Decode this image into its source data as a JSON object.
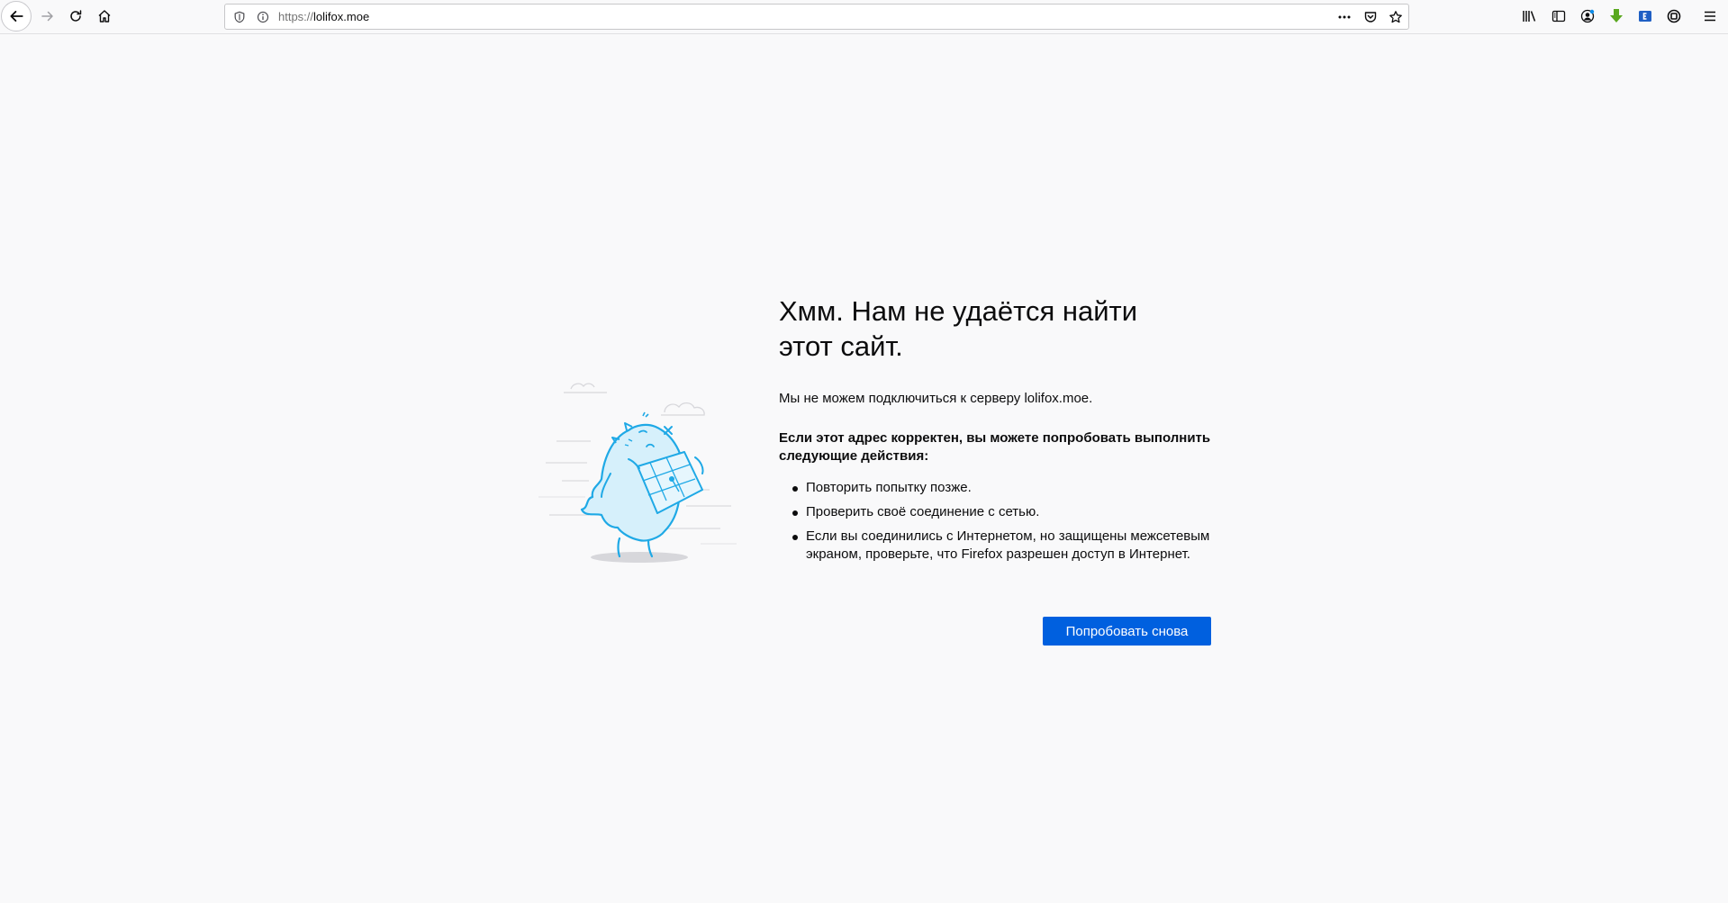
{
  "browser": {
    "url_scheme": "https://",
    "url_host": "lolifox.moe",
    "toolbar_icons": {
      "back": "arrow-left-icon",
      "forward": "arrow-right-icon",
      "reload": "reload-icon",
      "home": "home-icon",
      "tracking_protection": "shield-icon",
      "site_info": "info-icon",
      "page_actions": "more-horizontal-icon",
      "pocket": "pocket-icon",
      "bookmark": "star-icon",
      "library": "library-icon",
      "sidebar": "sidebar-icon",
      "account": "account-icon",
      "download_extension": "download-arrow-icon",
      "extension_blue": "extension-icon",
      "extension_dark": "extension-icon",
      "menu": "hamburger-menu-icon"
    },
    "accent_colors": {
      "download_green": "#5aa81f",
      "extension_blue": "#1f5fc4"
    }
  },
  "error_page": {
    "title": "Хмм. Нам не удаётся найти этот сайт.",
    "description": "Мы не можем подключиться к серверу lolifox.moe.",
    "suggestions_title": "Если этот адрес корректен, вы можете попробовать выполнить следующие действия:",
    "suggestions": [
      "Повторить попытку позже.",
      "Проверить своё соединение с сетью.",
      "Если вы соединились с Интернетом, но защищены межсетевым экраном, проверьте, что Firefox разрешен доступ в Интернет."
    ],
    "retry_label": "Попробовать снова",
    "button_color": "#0060df",
    "illustration": "confused-monster-with-map-illustration"
  }
}
